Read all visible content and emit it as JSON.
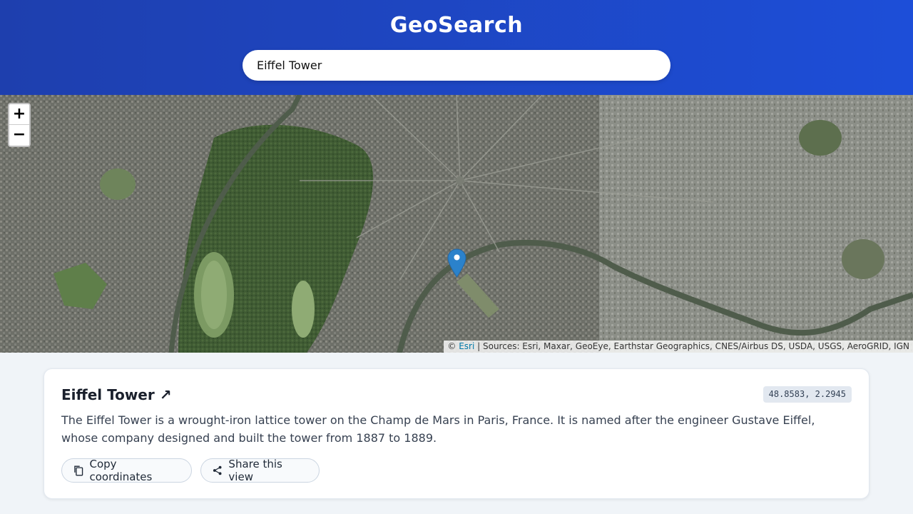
{
  "app": {
    "title": "GeoSearch"
  },
  "search": {
    "value": "Eiffel Tower",
    "placeholder": ""
  },
  "map": {
    "zoom_in_label": "+",
    "zoom_out_label": "−",
    "attribution_prefix": "© ",
    "attribution_link": "Esri",
    "attribution_sources": " | Sources: Esri, Maxar, GeoEye, Earthstar Geographics, CNES/Airbus DS, USDA, USGS, AeroGRID, IGN",
    "marker_icon": "map-pin-icon"
  },
  "result": {
    "title": "Eiffel Tower",
    "title_icon": "↗",
    "coordinates": "48.8583, 2.2945",
    "description": "The Eiffel Tower is a wrought-iron lattice tower on the Champ de Mars in Paris, France. It is named after the engineer Gustave Eiffel, whose company designed and built the tower from 1887 to 1889.",
    "copy_label": "Copy coordinates",
    "share_label": "Share this view"
  },
  "colors": {
    "header_start": "#1e3fae",
    "header_end": "#1d4ed8",
    "marker": "#2b82cb",
    "link": "#0078a8"
  }
}
